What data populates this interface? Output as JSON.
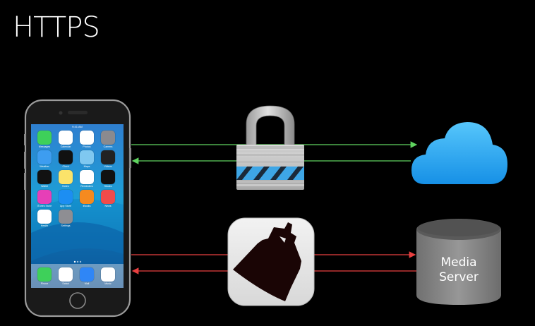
{
  "title": "HTTPS",
  "media_server_label": "Media\nServer",
  "colors": {
    "background": "#000000",
    "secure_arrow": "#5fd35f",
    "insecure_arrow": "#e84040",
    "cloud": "#2aa8ee",
    "server": "#8a8a8a"
  },
  "phone": {
    "status_time": "9:41 AM",
    "apps": [
      {
        "label": "Messages",
        "icon": "messages-icon",
        "color": "#3ed05a"
      },
      {
        "label": "Calendar",
        "icon": "calendar-icon",
        "color": "#ffffff"
      },
      {
        "label": "Photos",
        "icon": "photos-icon",
        "color": "#ffffff"
      },
      {
        "label": "Camera",
        "icon": "camera-icon",
        "color": "#8a8a8f"
      },
      {
        "label": "Weather",
        "icon": "weather-icon",
        "color": "#3d9df0"
      },
      {
        "label": "Clock",
        "icon": "clock-icon",
        "color": "#111111"
      },
      {
        "label": "Maps",
        "icon": "maps-icon",
        "color": "#7fc8f0"
      },
      {
        "label": "Videos",
        "icon": "videos-icon",
        "color": "#222222"
      },
      {
        "label": "Wallet",
        "icon": "wallet-icon",
        "color": "#111111"
      },
      {
        "label": "Notes",
        "icon": "notes-icon",
        "color": "#fbe36a"
      },
      {
        "label": "Reminders",
        "icon": "reminders-icon",
        "color": "#ffffff"
      },
      {
        "label": "Stocks",
        "icon": "stocks-icon",
        "color": "#111111"
      },
      {
        "label": "iTunes Store",
        "icon": "itunes-icon",
        "color": "#e63fb7"
      },
      {
        "label": "App Store",
        "icon": "appstore-icon",
        "color": "#1c8ef2"
      },
      {
        "label": "iBooks",
        "icon": "ibooks-icon",
        "color": "#f58a1f"
      },
      {
        "label": "News",
        "icon": "news-icon",
        "color": "#f04b4b"
      },
      {
        "label": "Health",
        "icon": "health-icon",
        "color": "#ffffff"
      },
      {
        "label": "Settings",
        "icon": "settings-icon",
        "color": "#8e8e93"
      }
    ],
    "dock": [
      {
        "label": "Phone",
        "icon": "phone-icon",
        "color": "#3ed05a"
      },
      {
        "label": "Safari",
        "icon": "safari-icon",
        "color": "#ffffff"
      },
      {
        "label": "Mail",
        "icon": "mail-icon",
        "color": "#2f86f6"
      },
      {
        "label": "Music",
        "icon": "music-icon",
        "color": "#ffffff"
      }
    ]
  }
}
